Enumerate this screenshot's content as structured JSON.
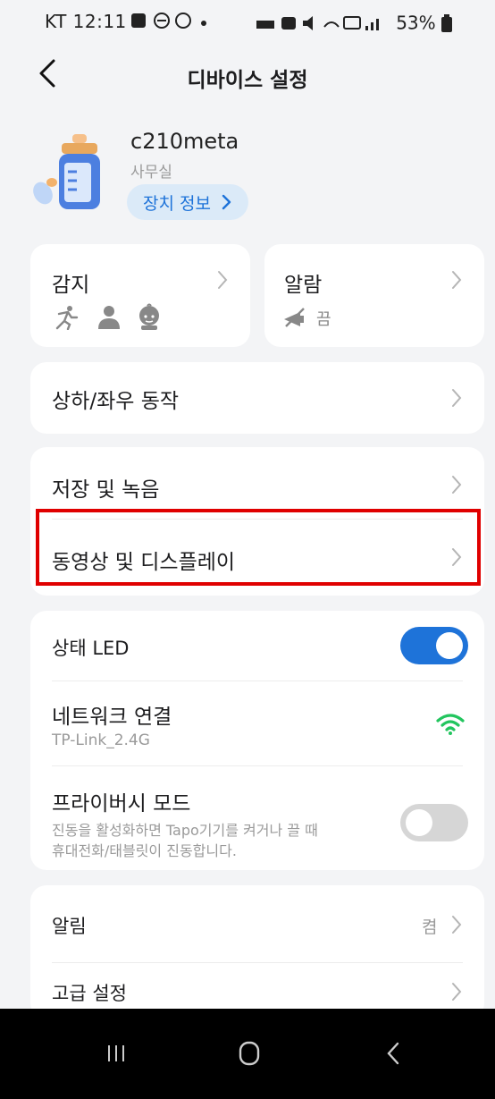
{
  "status_bar": {
    "left": "KT 12:11",
    "right": "53%"
  },
  "header": {
    "title": "디바이스 설정"
  },
  "device": {
    "name": "c210meta",
    "room": "사무실",
    "info_label": "장치 정보"
  },
  "detect_card": {
    "label": "감지",
    "icons": [
      "running-person-icon",
      "person-icon",
      "baby-icon"
    ]
  },
  "alarm_card": {
    "label": "알람",
    "status": "끔",
    "icon": "alarm-off-icon"
  },
  "pan_tilt": {
    "label": "상하/좌우 동작"
  },
  "storage": {
    "label": "저장 및 녹음"
  },
  "video_display": {
    "label": "동영상 및 디스플레이"
  },
  "status_led": {
    "label": "상태 LED",
    "on": true
  },
  "network": {
    "label": "네트워크 연결",
    "ssid": "TP-Link_2.4G",
    "icon": "wifi-icon"
  },
  "privacy": {
    "label": "프라이버시 모드",
    "desc_line1": "진동을 활성화하면 Tapo기기를 켜거나 끌 때",
    "desc_line2": "휴대전화/태블릿이 진동합니다.",
    "on": false
  },
  "notifications": {
    "label": "알림",
    "value": "켬"
  },
  "advanced": {
    "label": "고급 설정"
  },
  "colors": {
    "accent": "#1e73d9",
    "highlight_box": "#e00000",
    "wifi": "#22c55e",
    "toggle_off": "#d6d6d6"
  }
}
